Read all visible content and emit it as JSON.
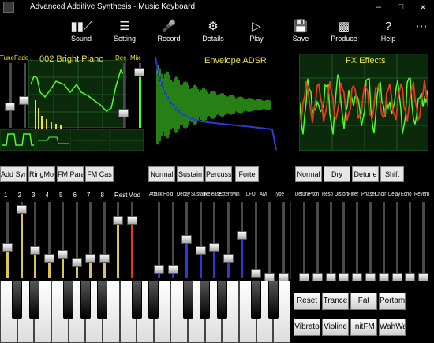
{
  "window": {
    "title": "Advanced Additive Synthesis   - Music Keyboard",
    "minimize_icon": "minimize-icon",
    "maximize_icon": "maximize-icon",
    "close_icon": "close-icon"
  },
  "toolbar": {
    "items": [
      {
        "label": "Sound",
        "icon": "library-icon"
      },
      {
        "label": "Setting",
        "icon": "list-icon"
      },
      {
        "label": "Record",
        "icon": "microphone-icon"
      },
      {
        "label": "Details",
        "icon": "gear-icon"
      },
      {
        "label": "Play",
        "icon": "play-icon"
      },
      {
        "label": "Save",
        "icon": "save-icon"
      },
      {
        "label": "Produce",
        "icon": "produce-icon"
      },
      {
        "label": "Help",
        "icon": "help-icon"
      }
    ],
    "more_icon": "more-icon"
  },
  "panels": {
    "sound": {
      "title": "002 Bright Piano",
      "tune_label": "Tune",
      "fade_label": "Fade",
      "dec_label": "Dec",
      "mix_label": "Mix"
    },
    "envelope": {
      "title": "Envelope ADSR"
    },
    "fx": {
      "title": "FX Effects"
    }
  },
  "left_buttons": [
    "Add Syn",
    "RingMod",
    "FM Paral",
    "FM Cas"
  ],
  "env_buttons": [
    "Normal",
    "Sustain",
    "Percussi",
    "Forte"
  ],
  "fx_buttons": [
    "Normal",
    "Dry",
    "Detune",
    "Shift"
  ],
  "harmonic_labels": [
    "1",
    "2",
    "3",
    "4",
    "5",
    "6",
    "7",
    "8",
    "Rest",
    "Mod"
  ],
  "env_labels": [
    "Attack",
    "Hold",
    "Decay",
    "Sustain",
    "Release",
    "Extent",
    "Min",
    "LFO",
    "AM",
    "Type"
  ],
  "fx_labels": [
    "Detune",
    "Pitch",
    "Reso",
    "Distort",
    "Filter",
    "Phaser",
    "Choir",
    "Delay",
    "Echo",
    "Reverb"
  ],
  "preset_buttons": [
    [
      "Reset",
      "Trance",
      "Fat",
      "Portame"
    ],
    [
      "Vibrato",
      "Violine",
      "InitFM",
      "WahWah"
    ]
  ],
  "harmonic_levels": [
    0.4,
    0.9,
    0.35,
    0.25,
    0.3,
    0.2,
    0.25,
    0.25,
    0.75,
    0.75
  ],
  "env_levels": [
    0.1,
    0.1,
    0.5,
    0.35,
    0.4,
    0.25,
    0.55,
    0.05,
    0.0,
    0.0
  ],
  "fx_levels": [
    0.0,
    0.0,
    0.0,
    0.0,
    0.0,
    0.0,
    0.0,
    0.0,
    0.0,
    0.0
  ],
  "colors": {
    "wave_green": "#4cff2a",
    "accent_yellow": "#e8e24a",
    "fx_red": "#e33b1f",
    "env_blue": "#2a3bd6"
  }
}
